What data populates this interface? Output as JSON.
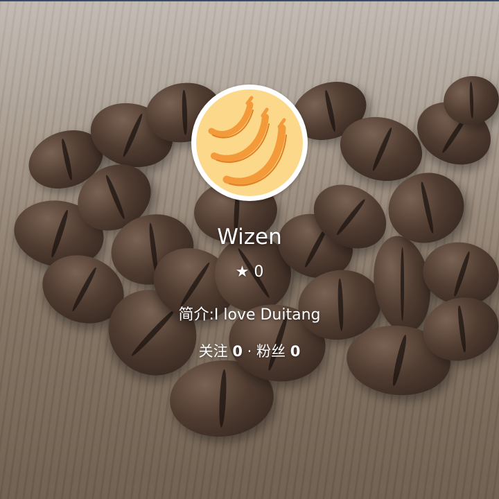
{
  "profile": {
    "name": "Wizen",
    "star_icon": "★",
    "star_count": "0",
    "bio_label": "简介:",
    "bio_text": "I love Duitang",
    "following_label": "关注",
    "following_count": "0",
    "separator": "·",
    "followers_label": "粉丝",
    "followers_count": "0",
    "avatar_icon": "banana-icon",
    "avatar_bg_color": "#fcd98a",
    "avatar_banana_color": "#f39a3a"
  }
}
